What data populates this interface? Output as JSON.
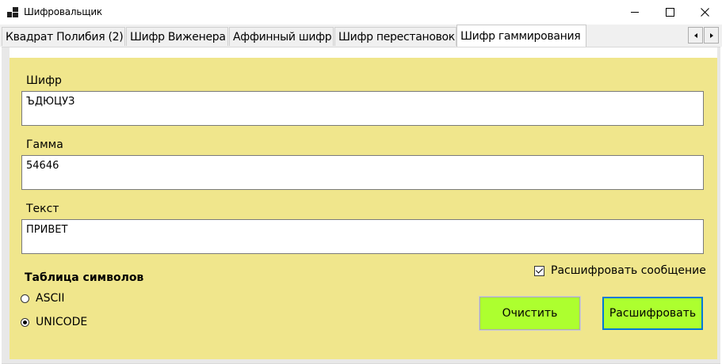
{
  "window": {
    "title": "Шифровальщик"
  },
  "tabs": [
    {
      "label": "Квадрат Полибия (2)"
    },
    {
      "label": "Шифр Виженера"
    },
    {
      "label": "Аффинный шифр"
    },
    {
      "label": "Шифр перестановок"
    },
    {
      "label": "Шифр гаммирования"
    }
  ],
  "active_tab": "Шифр гаммирования",
  "form": {
    "cipher_label": "Шифр",
    "cipher_value": "ЪДЮЦУЗ",
    "gamma_label": "Гамма",
    "gamma_value": "54646",
    "text_label": "Текст",
    "text_value": "ПРИВЕТ",
    "table_title": "Таблица символов",
    "radio_ascii": "ASCII",
    "radio_unicode": "UNICODE",
    "selected_table": "UNICODE",
    "decrypt_check_label": "Расшифровать сообщение",
    "decrypt_checked": true,
    "clear_button": "Очистить",
    "decrypt_button": "Расшифровать"
  },
  "colors": {
    "panel_background": "#f0e68c",
    "button_background": "#adff2f",
    "focus_border": "#0078d7"
  },
  "icons": {
    "app": "app-window-icon",
    "minimize": "minimize-icon",
    "maximize": "maximize-icon",
    "close": "close-icon",
    "tab_scroll_left": "chevron-left-icon",
    "tab_scroll_right": "chevron-right-icon"
  }
}
